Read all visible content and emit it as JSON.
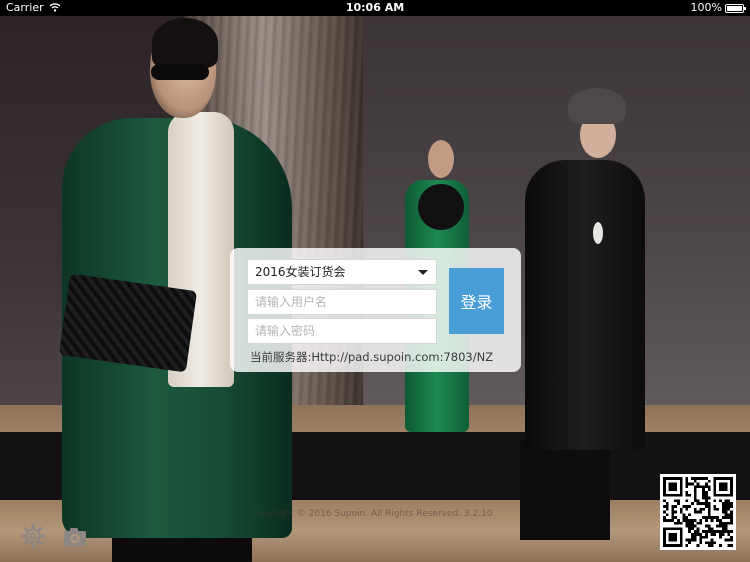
{
  "status_bar": {
    "carrier": "Carrier",
    "wifi_icon": "wifi-icon",
    "time": "10:06 AM",
    "battery_percent": "100%",
    "battery_level": 1.0
  },
  "login": {
    "fair_select": {
      "selected": "2016女装订货会",
      "icon": "chevron-down-icon"
    },
    "username_placeholder": "请输入用户名",
    "password_placeholder": "请输入密码",
    "login_button": "登录",
    "server_text": "当前服务器:Http://pad.supoin.com:7803/NZ"
  },
  "footer": {
    "copyright": "Copyright © 2016 Supoin. All Rights Reserved. 3.2.10",
    "settings_icon": "gear-icon",
    "camera_icon": "camera-icon",
    "qr_icon": "qr-code"
  },
  "colors": {
    "accent": "#4a9ed8",
    "status_bar_bg": "#000000",
    "panel_bg": "rgba(255,255,255,0.82)"
  }
}
